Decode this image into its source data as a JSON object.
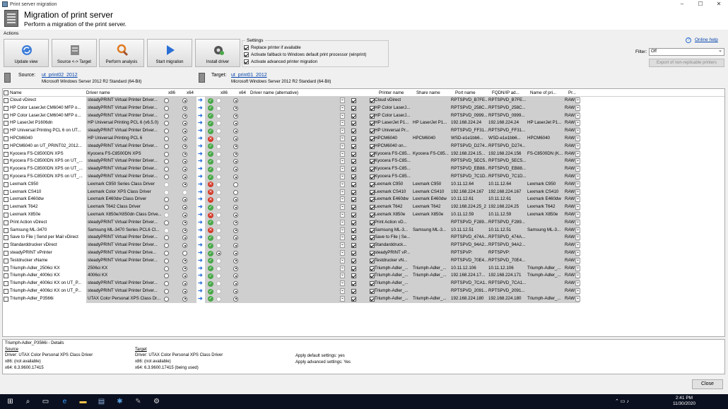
{
  "window": {
    "title": "Print server migration",
    "controls": [
      "–",
      "☐",
      "✕"
    ]
  },
  "header": {
    "title": "Migration of print server",
    "subtitle": "Perform a migration of the print server."
  },
  "actions": {
    "label": "Actions",
    "buttons": [
      {
        "label": "Update view",
        "icon": "refresh-icon"
      },
      {
        "label": "Source <-> Target",
        "icon": "swap-icon"
      },
      {
        "label": "Perform analysis",
        "icon": "magnifier-icon"
      },
      {
        "label": "Start migration",
        "icon": "play-icon"
      },
      {
        "label": "Install driver",
        "icon": "gear-icon"
      }
    ]
  },
  "settings": {
    "label": "Settings",
    "options": [
      {
        "label": "Replace printer if available",
        "checked": true
      },
      {
        "label": "Activate fallback to Windows default print processor (winprint)",
        "checked": true
      },
      {
        "label": "Activate advanced printer migration",
        "checked": true
      }
    ]
  },
  "help": {
    "label": "Online help"
  },
  "filter": {
    "label": "Filter:",
    "value": "Off",
    "export_label": "Export of non-replicable printers"
  },
  "source": {
    "label": "Source:",
    "server": "ut_print02_2012",
    "os": "Microsoft Windows Server 2012 R2 Standard (64-Bit)"
  },
  "target": {
    "label": "Target:",
    "server": "ut_print01_2012",
    "os": "Microsoft Windows Server 2012 R2 Standard (64-Bit)"
  },
  "grid": {
    "columns": {
      "name": "Name",
      "driver": "Driver name",
      "x86": "x86",
      "x64": "x64",
      "tx86": "x86",
      "tx64": "x64",
      "alt": "Driver name (alternative)",
      "pname": "Printer name",
      "share": "Share name",
      "port": "Port name",
      "fqdn": "FQDN/IP ad...",
      "portname": "Name of pri...",
      "pr": "Pr..."
    },
    "rows": [
      {
        "name": "Cloud vDirect",
        "driver": "steadyPRINT Virtual Printer Driver...",
        "sx86": "off",
        "sx64": "on",
        "st": "ok",
        "tx86": "none",
        "tx64": "on",
        "pname": "Cloud vDirect",
        "share": "",
        "port": "RPTSPVD_B7FE...",
        "fqdn": "RPTSPVD_B7FE...",
        "pn": "",
        "pr": "RAW"
      },
      {
        "name": "HP Color LaserJet CM6040 MFP o...",
        "driver": "steadyPRINT Virtual Printer Driver...",
        "sx86": "off",
        "sx64": "on",
        "st": "ok",
        "tx86": "none",
        "tx64": "on",
        "pname": "HP Color LaserJ...",
        "share": "",
        "port": "RPTSPVD_258C...",
        "fqdn": "RPTSPVD_258C...",
        "pn": "",
        "pr": "RAW"
      },
      {
        "name": "HP Color LaserJet CM6040 MFP o...",
        "driver": "steadyPRINT Virtual Printer Driver...",
        "sx86": "off",
        "sx64": "on",
        "st": "ok",
        "tx86": "none",
        "tx64": "on",
        "pname": "HP Color LaserJ...",
        "share": "",
        "port": "RPTSPVD_0999...",
        "fqdn": "RPTSPVD_0999...",
        "pn": "",
        "pr": "RAW"
      },
      {
        "name": "HP LaserJet P1606dn",
        "driver": "HP Universal Printing PCL 6 (v6.5.0)",
        "sx86": "off",
        "sx64": "on",
        "st": "ok",
        "tx86": "none",
        "tx64": "on",
        "pname": "HP LaserJet P1...",
        "share": "HP LaserJet P1...",
        "port": "192.168.224.24",
        "fqdn": "192.168.224.24",
        "pn": "HP LaserJet P1...",
        "pr": "RAW"
      },
      {
        "name": "HP Universal Printing PCL 6 on UT...",
        "driver": "steadyPRINT Virtual Printer Driver...",
        "sx86": "off",
        "sx64": "on",
        "st": "ok",
        "tx86": "none",
        "tx64": "on",
        "pname": "HP Universal Pr...",
        "share": "",
        "port": "RPTSPVD_FF31...",
        "fqdn": "RPTSPVD_FF31...",
        "pn": "",
        "pr": "RAW"
      },
      {
        "name": "HPCM6040",
        "driver": "HP Universal Printing PCL 6",
        "sx86": "off",
        "sx64": "on",
        "st": "bad",
        "tx86": "none",
        "tx64": "on",
        "pname": "HPCM6040",
        "share": "HPCM6040",
        "port": "WSD-e1e1bb6...",
        "fqdn": "WSD-e1e1bb6...",
        "pn": "HPCM6040",
        "pr": "RAW"
      },
      {
        "name": "HPCM6040 on UT_PRINT02_2012...",
        "driver": "steadyPRINT Virtual Printer Driver...",
        "sx86": "off",
        "sx64": "on",
        "st": "ok",
        "tx86": "none",
        "tx64": "on",
        "pname": "HPCM6040 on...",
        "share": "",
        "port": "RPTSPVD_D274...",
        "fqdn": "RPTSPVD_D274...",
        "pn": "",
        "pr": "RAW"
      },
      {
        "name": "Kyocera FS-C8500DN XPS",
        "driver": "Kyocera FS-C8500DN XPS",
        "sx86": "off",
        "sx64": "on",
        "st": "ok",
        "tx86": "none",
        "tx64": "on",
        "pname": "Kyocera FS-C85...",
        "share": "Kyocera FS-C85...",
        "port": "192.168.224.15...",
        "fqdn": "192.168.224.156",
        "pn": "FS-C8500DN (K...",
        "pr": "RAW"
      },
      {
        "name": "Kyocera FS-C8500DN XPS on UT_...",
        "driver": "steadyPRINT Virtual Printer Driver...",
        "sx86": "off",
        "sx64": "on",
        "st": "ok",
        "tx86": "none",
        "tx64": "on",
        "pname": "Kyocera FS-C85...",
        "share": "",
        "port": "RPTSPVD_5EC5...",
        "fqdn": "RPTSPVD_5EC5...",
        "pn": "",
        "pr": "RAW"
      },
      {
        "name": "Kyocera FS-C8500DN XPS on UT_...",
        "driver": "steadyPRINT Virtual Printer Driver...",
        "sx86": "off",
        "sx64": "on",
        "st": "ok",
        "tx86": "none",
        "tx64": "on",
        "pname": "Kyocera FS-C85...",
        "share": "",
        "port": "RPTSPVD_EB88...",
        "fqdn": "RPTSPVD_EB88...",
        "pn": "",
        "pr": "RAW"
      },
      {
        "name": "Kyocera FS-C8500DN XPS on UT_...",
        "driver": "steadyPRINT Virtual Printer Driver...",
        "sx86": "off",
        "sx64": "on",
        "st": "ok",
        "tx86": "none",
        "tx64": "on",
        "pname": "Kyocera FS-C85...",
        "share": "",
        "port": "RPTSPVD_7C1D...",
        "fqdn": "RPTSPVD_7C1D...",
        "pn": "",
        "pr": "RAW"
      },
      {
        "name": "Lexmark C950",
        "driver": "Lexmark C950 Series Class Driver",
        "sx86": "dis",
        "sx64": "on",
        "st": "bad",
        "tx86": "none",
        "tx64": "off",
        "pname": "Lexmark C950",
        "share": "Lexmark C950",
        "port": "10.11.12.64",
        "fqdn": "10.11.12.64",
        "pn": "Lexmark C950",
        "pr": "RAW"
      },
      {
        "name": "Lexmark CS410",
        "driver": "Lexmark Color XPS Class Driver",
        "sx86": "dis",
        "sx64": "dis",
        "st": "bad",
        "tx86": "none",
        "tx64": "off",
        "pname": "Lexmark CS410",
        "share": "Lexmark CS410",
        "port": "192.168.224.167",
        "fqdn": "192.168.224.167",
        "pn": "Lexmark CS410",
        "pr": "RAW"
      },
      {
        "name": "Lexmark E460dw",
        "driver": "Lexmark E460dw Class Driver",
        "sx86": "off",
        "sx64": "on",
        "st": "bad",
        "tx86": "none",
        "tx64": "on",
        "pname": "Lexmark E460dw",
        "share": "Lexmark E460dw",
        "port": "10.11.12.61",
        "fqdn": "10.11.12.61",
        "pn": "Lexmark E460dw",
        "pr": "RAW"
      },
      {
        "name": "Lexmark T642",
        "driver": "Lexmark T642 Class Driver",
        "sx86": "off",
        "sx64": "on",
        "st": "ok",
        "tx86": "none",
        "tx64": "on",
        "pname": "Lexmark T642",
        "share": "Lexmark T642",
        "port": "192.168.224.25_2",
        "fqdn": "192.168.224.25",
        "pn": "Lexmark T642",
        "pr": "RAW"
      },
      {
        "name": "Lexmark X850e",
        "driver": "Lexmark X850e/X850dn Class Drive...",
        "sx86": "dis",
        "sx64": "on",
        "st": "bad",
        "tx86": "none",
        "tx64": "on",
        "pname": "Lexmark X850e",
        "share": "Lexmark X850e",
        "port": "10.11.12.59",
        "fqdn": "10.11.12.59",
        "pn": "Lexmark X850e",
        "pr": "RAW"
      },
      {
        "name": "Print Action vDirect",
        "driver": "steadyPRINT Virtual Printer Driver...",
        "sx86": "off",
        "sx64": "on",
        "st": "ok",
        "tx86": "none",
        "tx64": "on",
        "pname": "Print Action vD...",
        "share": "",
        "port": "RPTSPVD_F289...",
        "fqdn": "RPTSPVD_F289...",
        "pn": "",
        "pr": "RAW"
      },
      {
        "name": "Samsung ML-3470",
        "driver": "Samsung ML-3470 Series PCL6 Cl...",
        "sx86": "dis",
        "sx64": "on",
        "st": "bad",
        "tx86": "none",
        "tx64": "on",
        "pname": "Samsung ML-3...",
        "share": "Samsung ML-3...",
        "port": "10.11.12.51",
        "fqdn": "10.11.12.51",
        "pn": "Samsung ML-3...",
        "pr": "RAW"
      },
      {
        "name": "Save to File | Send per Mail vDirect",
        "driver": "steadyPRINT Virtual Printer Driver...",
        "sx86": "off",
        "sx64": "on",
        "st": "ok",
        "tx86": "none",
        "tx64": "on",
        "pname": "Save to File | Se...",
        "share": "",
        "port": "RPTSPVD_474A...",
        "fqdn": "RPTSPVD_474A...",
        "pn": "",
        "pr": "RAW"
      },
      {
        "name": "Standarddrucker vDirect",
        "driver": "steadyPRINT Virtual Printer Driver...",
        "sx86": "off",
        "sx64": "on",
        "st": "ok",
        "tx86": "none",
        "tx64": "on",
        "pname": "Standarddruck...",
        "share": "",
        "port": "RPTSPVD_94A2...",
        "fqdn": "RPTSPVD_94A2...",
        "pn": "",
        "pr": "RAW"
      },
      {
        "name": "steadyPRINT vPrinter",
        "driver": "steadyPRINT Virtual Printer Drive...",
        "sx86": "off",
        "sx64": "off",
        "st": "ok",
        "tx86": "on",
        "tx64": "on",
        "pname": "steadyPRINT vP...",
        "share": "",
        "port": "RPTSPVP:",
        "fqdn": "RPTSPVP:",
        "pn": "",
        "pr": "RAW"
      },
      {
        "name": "Testdrucker vName",
        "driver": "steadyPRINT Virtual Printer Driver...",
        "sx86": "off",
        "sx64": "on",
        "st": "ok",
        "tx86": "none",
        "tx64": "on",
        "pname": "Testdrucker vN...",
        "share": "",
        "port": "RPTSPVD_70E4...",
        "fqdn": "RPTSPVD_70E4...",
        "pn": "",
        "pr": "RAW"
      },
      {
        "name": "Triumph-Adler_2506ci KX",
        "driver": "2506ci KX",
        "sx86": "off",
        "sx64": "on",
        "st": "ok",
        "tx86": "none",
        "tx64": "on",
        "pname": "Triumph-Adler_...",
        "share": "Triumph-Adler_...",
        "port": "10.11.12.106",
        "fqdn": "10.11.12.106",
        "pn": "Triumph-Adler_...",
        "pr": "RAW"
      },
      {
        "name": "Triumph-Adler_4006ci KX",
        "driver": "4006ci KX",
        "sx86": "off",
        "sx64": "on",
        "st": "ok",
        "tx86": "none",
        "tx64": "on",
        "pname": "Triumph-Adler_...",
        "share": "Triumph-Adler_...",
        "port": "192.168.224.17...",
        "fqdn": "192.168.224.171",
        "pn": "Triumph-Adler_...",
        "pr": "RAW"
      },
      {
        "name": "Triumph-Adler_4006ci KX on UT_P...",
        "driver": "steadyPRINT Virtual Printer Driver...",
        "sx86": "off",
        "sx64": "on",
        "st": "ok",
        "tx86": "none",
        "tx64": "on",
        "pname": "Triumph-Adler_...",
        "share": "",
        "port": "RPTSPVD_7CA1...",
        "fqdn": "RPTSPVD_7CA1...",
        "pn": "",
        "pr": "RAW"
      },
      {
        "name": "Triumph-Adler_4006ci KX on UT_P...",
        "driver": "steadyPRINT Virtual Printer Driver...",
        "sx86": "off",
        "sx64": "on",
        "st": "ok",
        "tx86": "none",
        "tx64": "on",
        "pname": "Triumph-Adler_...",
        "share": "",
        "port": "RPTSPVD_2091...",
        "fqdn": "RPTSPVD_2091...",
        "pn": "",
        "pr": "RAW"
      },
      {
        "name": "Triumph-Adler_P3566i",
        "driver": "UTAX Color Personal XPS Class Dr...",
        "sx86": "off",
        "sx64": "on",
        "st": "ok",
        "tx86": "none",
        "tx64": "on",
        "pname": "Triumph-Adler_...",
        "share": "Triumph-Adler_...",
        "port": "192.168.224.180",
        "fqdn": "192.168.224.180",
        "pn": "Triumph-Adler_...",
        "pr": "RAW"
      }
    ]
  },
  "details": {
    "title": "Triumph-Adler_P3566i - Details",
    "source_label": "Source",
    "source_driver": "Driver: UTAX Color Personal XPS Class Driver",
    "source_x86": "x86: (not available)",
    "source_x64": "x64: 6.3.9600.17415",
    "target_label": "Target",
    "target_driver": "Driver: UTAX Color Personal XPS Class Driver",
    "target_x86": "x86: (not available)",
    "target_x64": "x64: 6.3.9600.17415 (being used)",
    "apply_default": "Apply default settings: yes",
    "apply_advanced": "Apply advanced settings: Yes"
  },
  "footer": {
    "close_label": "Close"
  },
  "taskbar": {
    "time": "2:41 PM",
    "date": "11/30/2020"
  }
}
